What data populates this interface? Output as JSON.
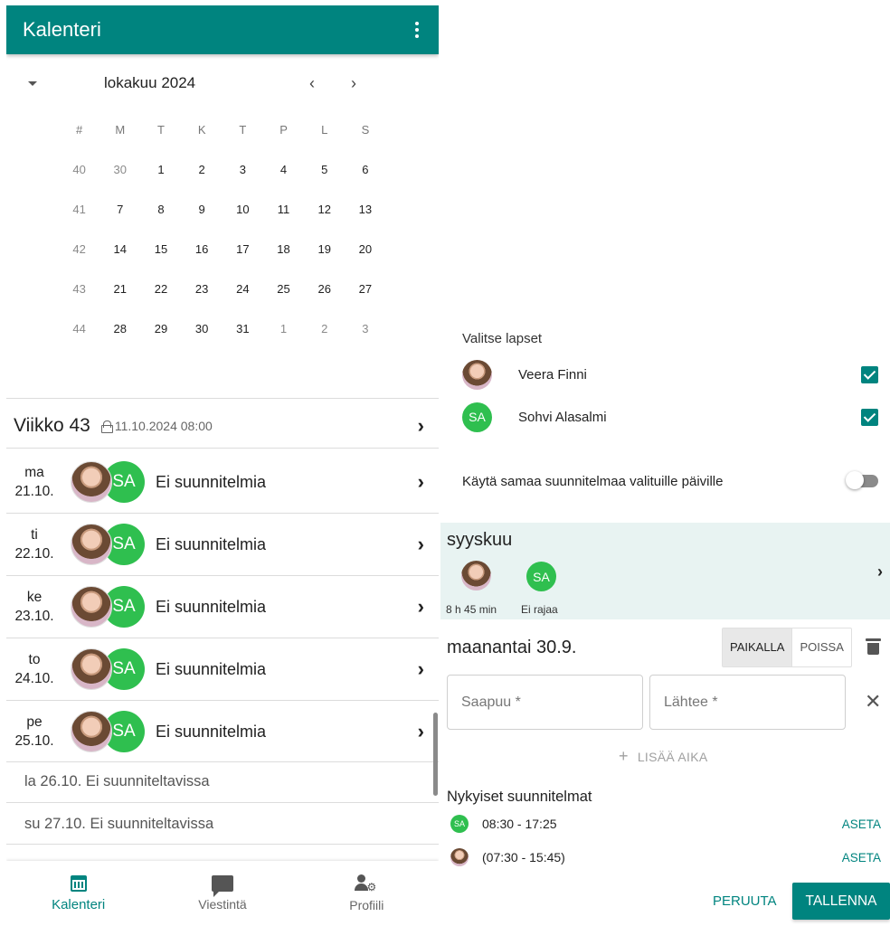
{
  "app": {
    "title": "Kalenteri"
  },
  "calendar": {
    "month_label": "lokakuu 2024",
    "weekday_headers": [
      "#",
      "M",
      "T",
      "K",
      "T",
      "P",
      "L",
      "S"
    ],
    "weeks": [
      {
        "week": "40",
        "days": [
          "30",
          "1",
          "2",
          "3",
          "4",
          "5",
          "6"
        ]
      },
      {
        "week": "41",
        "days": [
          "7",
          "8",
          "9",
          "10",
          "11",
          "12",
          "13"
        ]
      },
      {
        "week": "42",
        "days": [
          "14",
          "15",
          "16",
          "17",
          "18",
          "19",
          "20"
        ]
      },
      {
        "week": "43",
        "days": [
          "21",
          "22",
          "23",
          "24",
          "25",
          "26",
          "27"
        ]
      },
      {
        "week": "44",
        "days": [
          "28",
          "29",
          "30",
          "31",
          "1",
          "2",
          "3"
        ]
      }
    ]
  },
  "week_summary": {
    "title": "Viikko 43",
    "locked_at": "11.10.2024 08:00"
  },
  "days": [
    {
      "weekday": "ma",
      "date": "21.10.",
      "status": "Ei suunnitelmia",
      "avatar_initials": "SA"
    },
    {
      "weekday": "ti",
      "date": "22.10.",
      "status": "Ei suunnitelmia",
      "avatar_initials": "SA"
    },
    {
      "weekday": "ke",
      "date": "23.10.",
      "status": "Ei suunnitelmia",
      "avatar_initials": "SA"
    },
    {
      "weekday": "to",
      "date": "24.10.",
      "status": "Ei suunnitelmia",
      "avatar_initials": "SA"
    },
    {
      "weekday": "pe",
      "date": "25.10.",
      "status": "Ei suunnitelmia",
      "avatar_initials": "SA"
    }
  ],
  "non_plannable": [
    "la 26.10. Ei suunniteltavissa",
    "su 27.10. Ei suunniteltavissa"
  ],
  "bottom_nav": {
    "calendar": "Kalenteri",
    "messages": "Viestintä",
    "profile": "Profiili"
  },
  "children_panel": {
    "label": "Valitse lapset",
    "children": [
      {
        "name": "Veera Finni",
        "checked": true
      },
      {
        "name": "Sohvi Alasalmi",
        "initials": "SA",
        "checked": true
      }
    ],
    "same_plan_label": "Käytä samaa suunnitelmaa valituille päiville",
    "same_plan_enabled": false
  },
  "month_band": {
    "title": "syyskuu",
    "child1_info": "8 h 45 min",
    "child2_initials": "SA",
    "child2_info": "Ei rajaa"
  },
  "day_editor": {
    "title": "maanantai 30.9.",
    "present_label": "PAIKALLA",
    "absent_label": "POISSA",
    "arrives_placeholder": "Saapuu *",
    "leaves_placeholder": "Lähtee *",
    "add_time_label": "LISÄÄ AIKA",
    "plans_title": "Nykyiset suunnitelmat",
    "plans": [
      {
        "initials": "SA",
        "time": "08:30 - 17:25",
        "action": "ASETA"
      },
      {
        "time": "(07:30 - 15:45)",
        "action": "ASETA"
      }
    ],
    "cancel_label": "PERUUTA",
    "save_label": "TALLENNA"
  },
  "colors": {
    "brand": "#00847f",
    "avatar_green": "#2fbf4f",
    "band_bg": "#e8f3f2"
  }
}
